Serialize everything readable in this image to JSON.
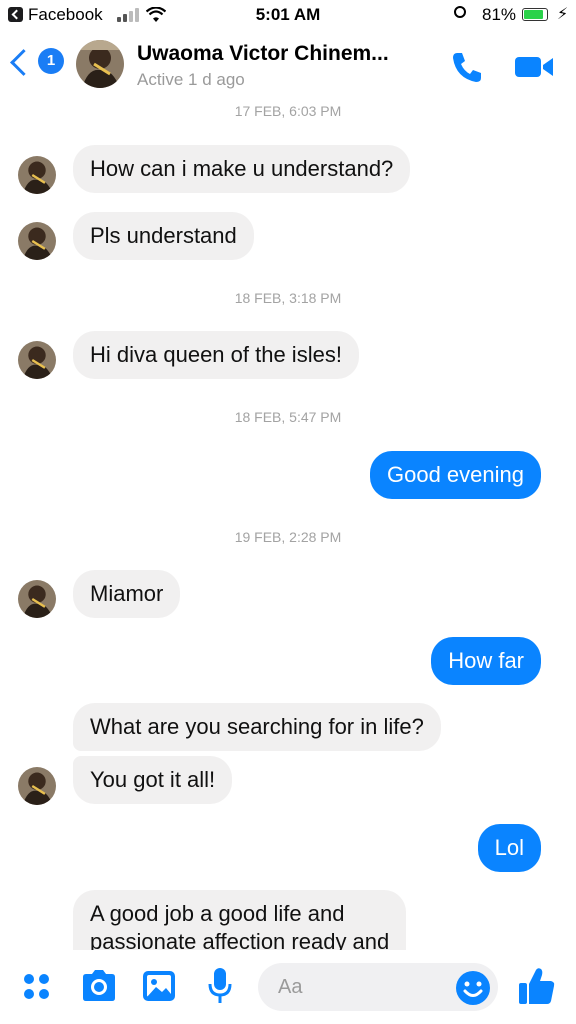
{
  "status_bar": {
    "app": "Facebook",
    "time": "5:01 AM",
    "battery": "81%"
  },
  "header": {
    "name": "Uwaoma Victor Chinem...",
    "status": "Active 1 d ago",
    "unread_badge": "1"
  },
  "thread": {
    "stamp_1": "17 FEB, 6:03 PM",
    "msg_1": "How can i make u understand?",
    "msg_2": "Pls understand",
    "stamp_2": "18 FEB, 3:18 PM",
    "msg_3": "Hi diva queen of the isles!",
    "stamp_3": "18 FEB, 5:47 PM",
    "msg_4": "Good evening",
    "stamp_4": "19 FEB, 2:28 PM",
    "msg_5": "Miamor",
    "msg_6": "How far",
    "msg_7": "What are you searching for in life?",
    "msg_8": "You got it all!",
    "msg_9": "Lol",
    "msg_10_line1": "A good job a good life and",
    "msg_10_line2": "passionate affection ready and"
  },
  "composer": {
    "placeholder": "Aa",
    "icons": [
      "apps-icon",
      "camera-icon",
      "gallery-icon",
      "mic-icon",
      "emoji-icon",
      "like-icon"
    ]
  },
  "colors": {
    "accent": "#0a84ff",
    "incoming_bubble": "#f1f0f0",
    "timestamp": "#a3a3a3"
  }
}
